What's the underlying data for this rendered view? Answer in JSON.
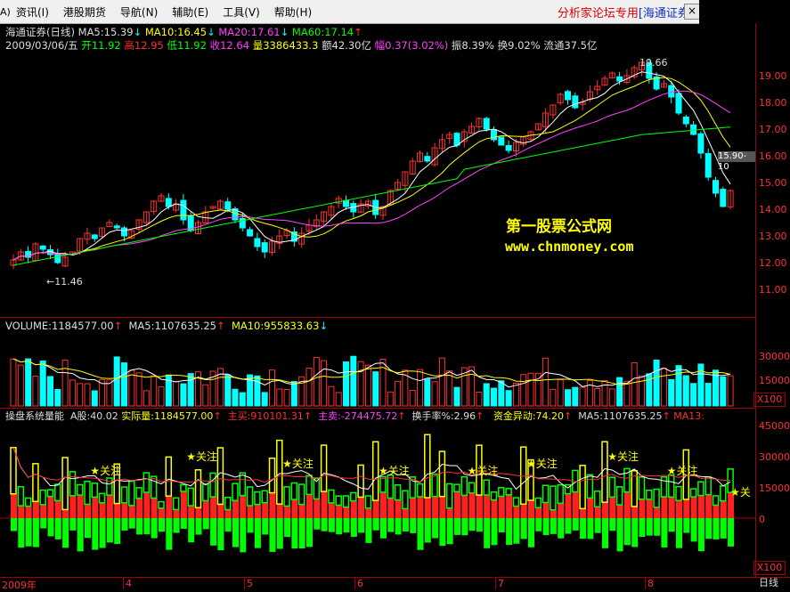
{
  "menu": {
    "items": [
      "资讯(I)",
      "港股期货",
      "导航(N)",
      "辅助(E)",
      "工具(V)",
      "帮助(H)"
    ],
    "title_a": "分析家论坛专用",
    "title_b": "[海通证券]",
    "close": "×",
    "left_glyph": "A)"
  },
  "colors": {
    "up": "#ff3030",
    "down": "#00ffff",
    "ma5": "#ffffff",
    "ma10": "#ffff00",
    "ma20": "#ff40ff",
    "ma60": "#00ff00"
  },
  "price_panel": {
    "header": [
      "海通证券(日线)",
      "MA5:15.39",
      "↓",
      "MA10:16.45",
      "↓",
      "MA20:17.61",
      "↓",
      "MA60:17.14",
      "↑"
    ],
    "info": [
      "2009/03/06/五",
      "开11.92",
      "高12.95",
      "低11.92",
      "收12.64",
      "量3386433.3",
      "额42.30亿",
      "幅0.37(3.02%)",
      "振8.39%",
      "换9.02%",
      "流通37.5亿"
    ],
    "y_labels": [
      "19.00",
      "18.00",
      "17.00",
      "16.00",
      "15.00",
      "14.00",
      "13.00",
      "12.00",
      "11.00"
    ],
    "high_label": "19.66",
    "low_label": "←11.46",
    "cursor_price": "15.90-10"
  },
  "volume_panel": {
    "header": [
      "VOLUME:1184577.00",
      "↑",
      "MA5:1107635.25",
      "↑",
      "MA10:955833.63",
      "↓"
    ],
    "y_labels": [
      "30000",
      "15000"
    ],
    "scale": "X100"
  },
  "indicator_panel": {
    "header": [
      "操盘系统量能",
      "A股:40.02",
      "实际量:1184577.00",
      "↑",
      "主买:910101.31",
      "↑",
      "主卖:-274475.72",
      "↑",
      "换手率%:2.96",
      "↑",
      "资金异动:74.20",
      "↑",
      "MA5:1107635.25",
      "↑",
      "MA13:"
    ],
    "y_labels": [
      "45000",
      "30000",
      "15000",
      "0"
    ],
    "scale": "X100",
    "star_label": "关注",
    "right_edge_label": "★关"
  },
  "watermark": {
    "line1": "第一股票公式网",
    "line2": "www.chnmoney.com"
  },
  "x_axis": {
    "labels": [
      "2009年",
      "4",
      "5",
      "6",
      "7",
      "8"
    ],
    "period_button": "日线"
  },
  "chart_data": {
    "type": "candlestick",
    "closes": [
      12.1,
      12.4,
      12.2,
      12.7,
      12.5,
      12.3,
      12.0,
      12.2,
      12.4,
      12.9,
      13.1,
      12.9,
      13.3,
      13.5,
      13.3,
      13.0,
      13.2,
      13.6,
      13.9,
      14.3,
      14.5,
      14.1,
      14.2,
      13.6,
      13.2,
      13.5,
      13.9,
      14.1,
      14.3,
      14.0,
      13.6,
      13.3,
      13.0,
      12.6,
      12.4,
      12.8,
      13.0,
      13.2,
      12.8,
      13.1,
      13.4,
      13.6,
      13.9,
      14.1,
      14.4,
      14.1,
      13.9,
      14.2,
      14.3,
      13.8,
      14.1,
      14.7,
      15.0,
      15.4,
      15.8,
      16.1,
      15.8,
      16.3,
      16.6,
      16.8,
      16.4,
      16.9,
      17.1,
      17.4,
      17.0,
      16.6,
      16.4,
      16.2,
      16.5,
      16.7,
      16.9,
      17.2,
      17.6,
      17.9,
      18.3,
      18.1,
      17.8,
      18.0,
      18.4,
      18.6,
      18.9,
      19.1,
      18.8,
      19.0,
      19.3,
      19.5,
      18.9,
      18.5,
      18.7,
      18.2,
      17.6,
      17.2,
      16.8,
      16.1,
      15.2,
      14.6,
      14.1,
      14.7
    ],
    "volume_axis": [
      15000,
      30000
    ],
    "indicator_axis": [
      0,
      15000,
      30000,
      45000
    ]
  }
}
